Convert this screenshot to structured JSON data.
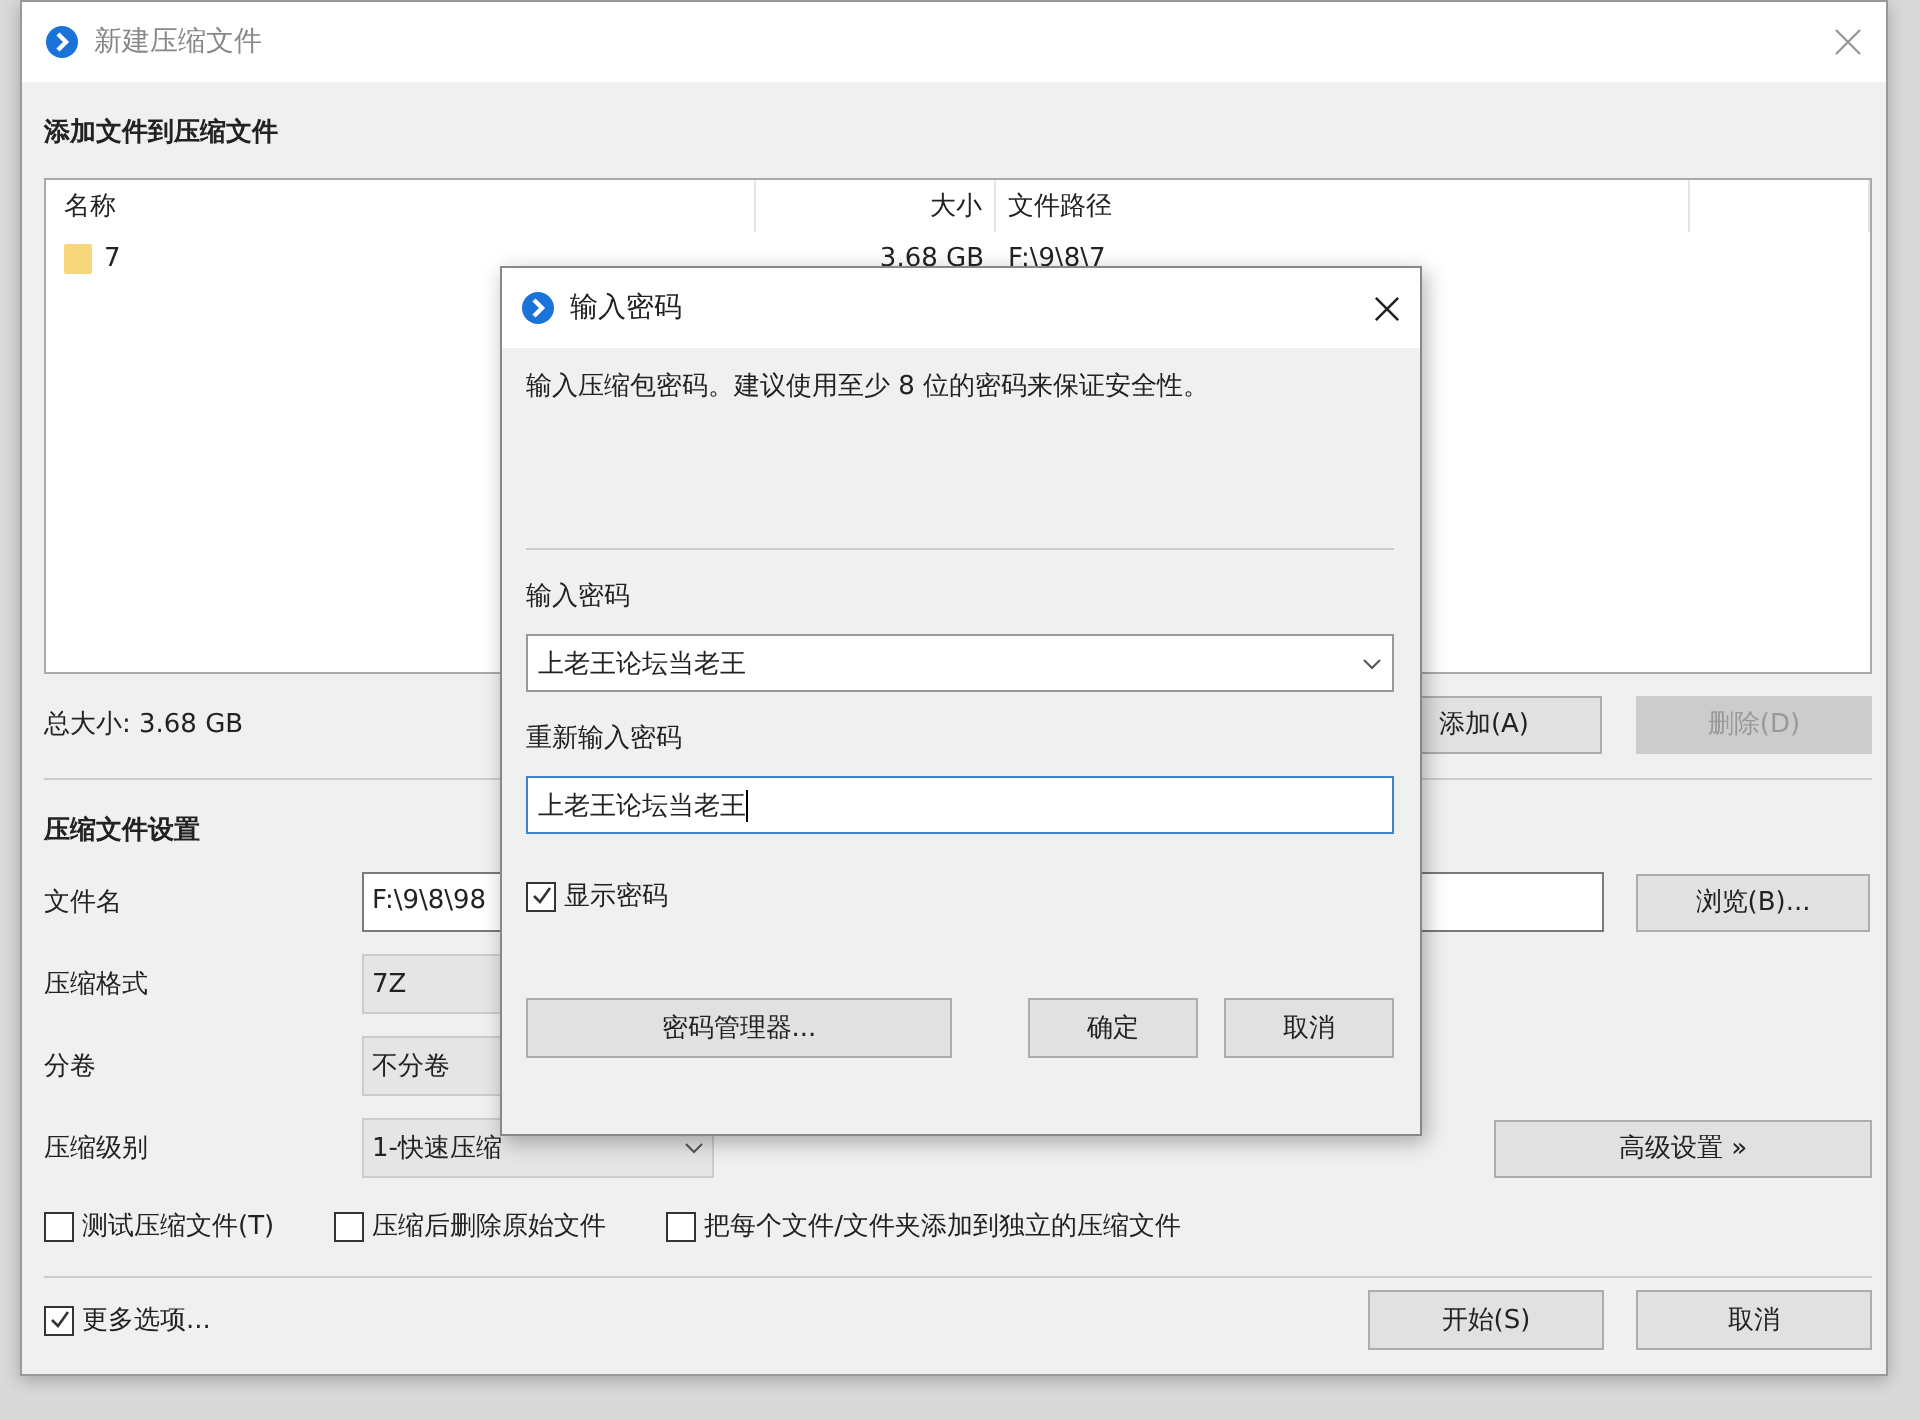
{
  "window": {
    "title": "新建压缩文件"
  },
  "files_heading": "添加文件到压缩文件",
  "file_list": {
    "columns": [
      "名称",
      "大小",
      "文件路径"
    ],
    "rows": [
      {
        "name": "7",
        "size": "3.68 GB",
        "path": "F:\\9\\8\\7"
      }
    ]
  },
  "total_size": "总大小: 3.68 GB",
  "list_buttons": [
    {
      "label": "添加(A)",
      "disabled": false
    },
    {
      "label": "删除(D)",
      "disabled": true
    }
  ],
  "settings_heading": "压缩文件设置",
  "settings": [
    {
      "kind": "text",
      "label": "文件名",
      "value": "F:\\9\\8\\98",
      "button": "浏览(B)..."
    },
    {
      "kind": "combo",
      "label": "压缩格式",
      "value": "7Z"
    },
    {
      "kind": "combo",
      "label": "分卷",
      "value": "不分卷"
    },
    {
      "kind": "dropdown",
      "label": "压缩级别",
      "value": "1-快速压缩",
      "button": "高级设置 »"
    }
  ],
  "options": [
    {
      "label": "测试压缩文件(T)",
      "checked": false
    },
    {
      "label": "压缩后删除原始文件",
      "checked": false
    },
    {
      "label": "把每个文件/文件夹添加到独立的压缩文件",
      "checked": false
    }
  ],
  "more_options": {
    "label": "更多选项...",
    "checked": true
  },
  "footer_buttons": [
    "开始(S)",
    "取消"
  ],
  "password_dialog": {
    "title": "输入密码",
    "message": "输入压缩包密码。建议使用至少 8 位的密码来保证安全性。",
    "password_label": "输入密码",
    "password": "上老王论坛当老王",
    "confirm_label": "重新输入密码",
    "confirm": "上老王论坛当老王",
    "show_password": {
      "label": "显示密码",
      "checked": true
    },
    "manager_button": "密码管理器...",
    "buttons": [
      "确定",
      "取消"
    ]
  }
}
